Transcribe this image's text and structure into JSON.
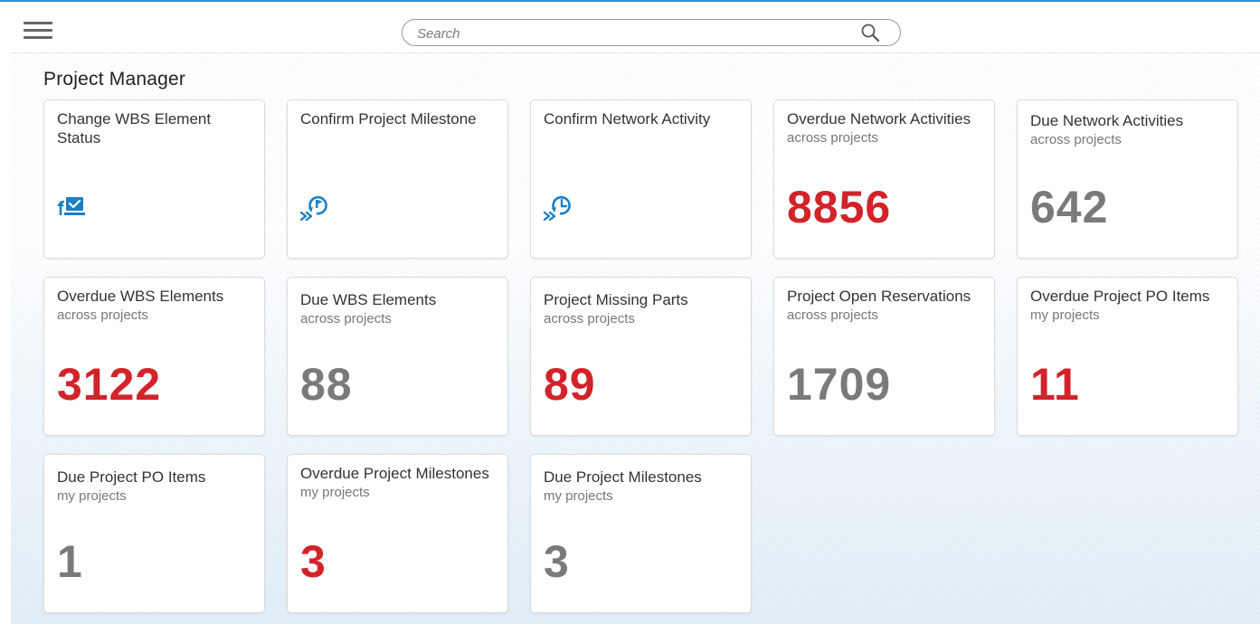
{
  "search": {
    "placeholder": "Search"
  },
  "page": {
    "title": "Project Manager"
  },
  "tiles": [
    {
      "title": "Change WBS Element Status",
      "subtitle": "",
      "icon": "change-status-icon"
    },
    {
      "title": "Confirm Project Milestone",
      "subtitle": "",
      "icon": "confirm-milestone-icon"
    },
    {
      "title": "Confirm Network Activity",
      "subtitle": "",
      "icon": "confirm-activity-icon"
    },
    {
      "title": "Overdue Network Activities",
      "subtitle": "across projects",
      "value": "8856",
      "state": "critical"
    },
    {
      "title": "Due Network Activities",
      "subtitle": "across projects",
      "value": "642",
      "state": "neutral"
    },
    {
      "title": "Overdue WBS Elements",
      "subtitle": "across projects",
      "value": "3122",
      "state": "critical"
    },
    {
      "title": "Due WBS Elements",
      "subtitle": "across projects",
      "value": "88",
      "state": "neutral"
    },
    {
      "title": "Project Missing Parts",
      "subtitle": "across projects",
      "value": "89",
      "state": "critical"
    },
    {
      "title": "Project Open Reservations",
      "subtitle": "across projects",
      "value": "1709",
      "state": "neutral"
    },
    {
      "title": "Overdue Project PO Items",
      "subtitle": "my projects",
      "value": "11",
      "state": "critical"
    },
    {
      "title": "Due Project PO Items",
      "subtitle": "my projects",
      "value": "1",
      "state": "neutral"
    },
    {
      "title": "Overdue Project Milestones",
      "subtitle": "my projects",
      "value": "3",
      "state": "critical"
    },
    {
      "title": "Due Project Milestones",
      "subtitle": "my projects",
      "value": "3",
      "state": "neutral"
    }
  ],
  "colors": {
    "accent": "#2f8fd3",
    "icon": "#1a7fc4",
    "critical": "#d2232a",
    "neutral": "#7a7a7a"
  }
}
